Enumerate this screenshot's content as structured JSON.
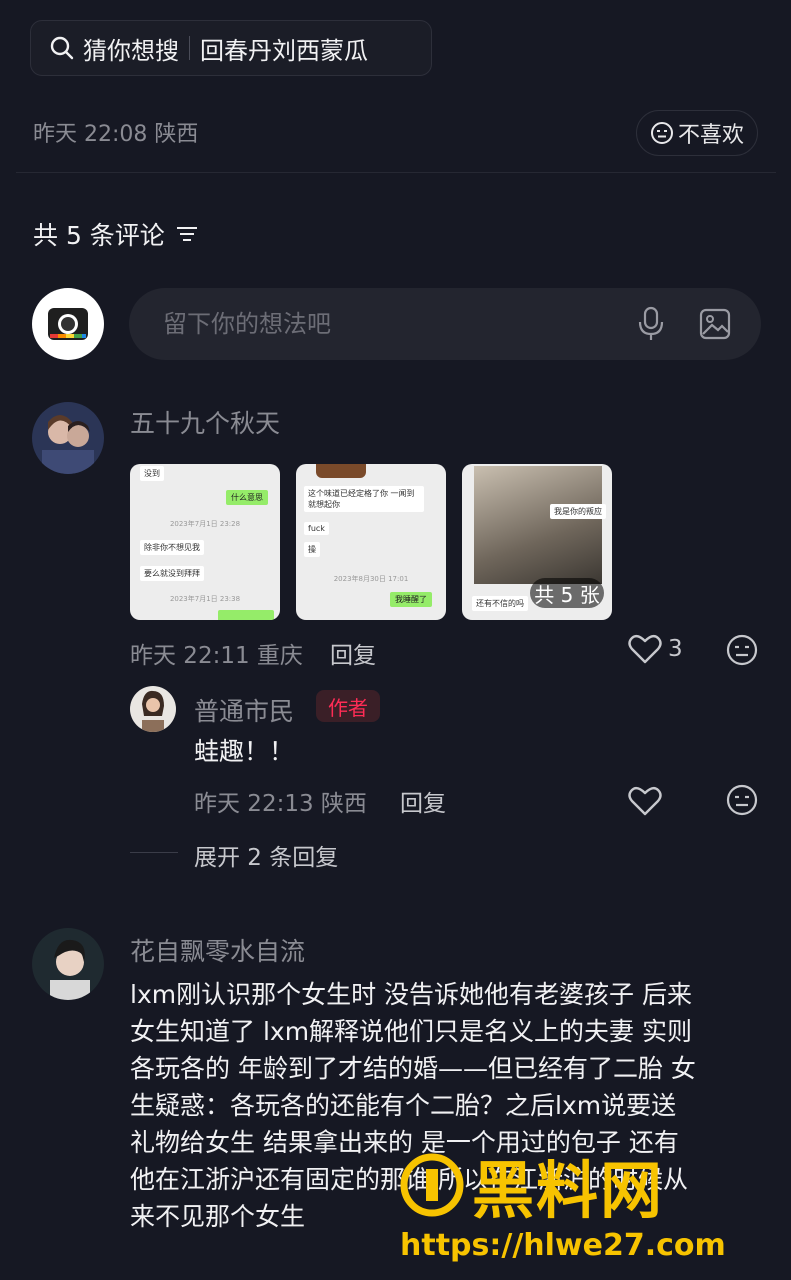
{
  "search": {
    "label": "猜你想搜",
    "suggestion": "回春丹刘西蒙瓜"
  },
  "post_meta": {
    "time_location": "昨天 22:08 陕西",
    "dislike_label": "不喜欢"
  },
  "comments_header": {
    "title": "共 5 条评论"
  },
  "comment_input": {
    "placeholder": "留下你的想法吧"
  },
  "comments": [
    {
      "user": "五十九个秋天",
      "images": [
        {
          "lines": [
            "没到",
            "什么意思",
            "2023年7月1日 23:28",
            "除非你不想见我",
            "要么就没到拜拜",
            "2023年7月1日 23:38"
          ]
        },
        {
          "lines": [
            "这个味道已经定格了你  一闻到就想起你",
            "fuck",
            "操",
            "2023年8月30日 17:01",
            "我睡醒了"
          ]
        },
        {
          "lines": [
            "我是你的叛应",
            "还有不信的吗"
          ]
        }
      ],
      "more_images_label": "共 5 张",
      "time_location": "昨天 22:11 重庆",
      "reply_label": "回复",
      "likes": "3",
      "replies": [
        {
          "user": "普通市民",
          "tag": "作者",
          "text": "蛙趣！！",
          "time_location": "昨天 22:13 陕西",
          "reply_label": "回复"
        }
      ],
      "expand_label": "展开 2 条回复"
    },
    {
      "user": "花自飘零水自流",
      "text_lines": [
        "lxm刚认识那个女生时 没告诉她他有老婆孩子 后来",
        "女生知道了 lxm解释说他们只是名义上的夫妻 实则",
        "各玩各的 年龄到了才结的婚——但已经有了二胎 女",
        "生疑惑：各玩各的还能有个二胎？之后lxm说要送",
        "礼物给女生 结果拿出来的 是一个用过的包子 还有",
        "他在江浙沪还有固定的那谁 所以在江浙沪的时候从",
        "来不见那个女生"
      ]
    }
  ],
  "watermark": {
    "logo": "黑料网",
    "url": "https://hlwe27.com"
  },
  "colors": {
    "background": "#161823",
    "accent": "#fe2c55",
    "watermark": "#f7c300"
  }
}
